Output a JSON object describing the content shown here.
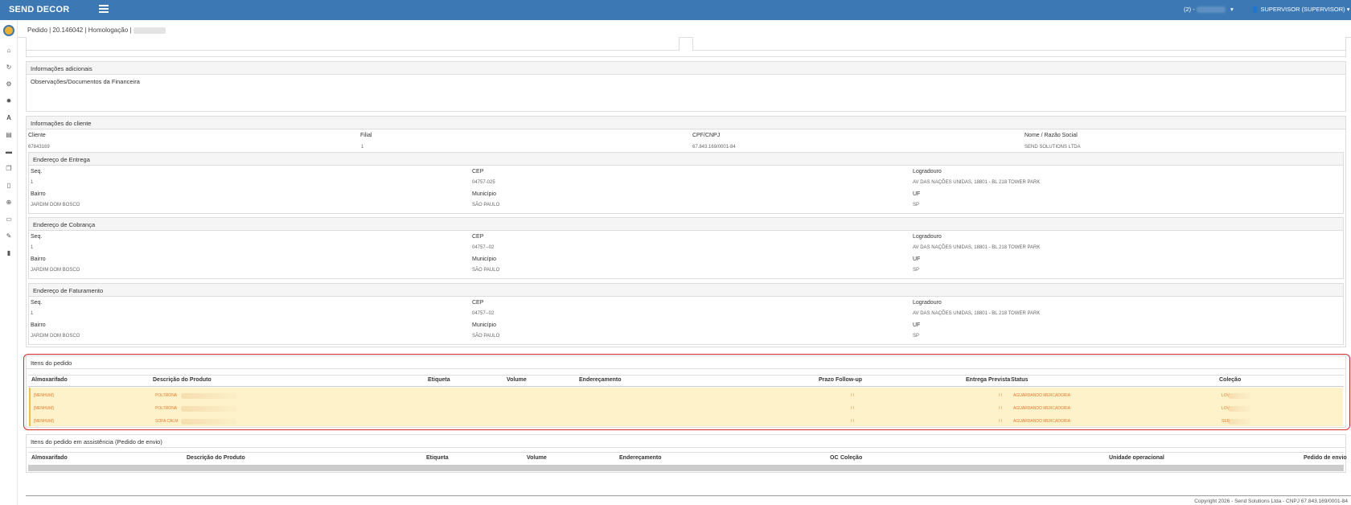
{
  "topbar": {
    "brand": "SEND DECOR",
    "env": "(2) -",
    "user": "SUPERVISOR (SUPERVISOR)"
  },
  "breadcrumb": "Pedido | 20.146042 | Homologação |",
  "additional_info": {
    "title": "Informações adicionais",
    "text": "Observações/Documentos da Financeira"
  },
  "client_info": {
    "title": "Informações do cliente",
    "headers": [
      "Cliente",
      "Filial",
      "CPF/CNPJ",
      "Nome / Razão Social"
    ],
    "values": [
      "67843169",
      "1",
      "67.843.169/0001-84",
      "SEND SOLUTIONS LTDA"
    ]
  },
  "addresses": [
    {
      "title": "Endereço de Entrega",
      "seq": "1",
      "cep": "04757-025",
      "logradouro": "AV DAS NAÇÕES UNIDAS, 18801 - BL 218 TOWER PARK",
      "bairro": "JARDIM DOM BOSCO",
      "municipio": "SÃO PAULO",
      "uf": "SP"
    },
    {
      "title": "Endereço de Cobrança",
      "seq": "1",
      "cep": "04757--02",
      "logradouro": "AV DAS NAÇÕES UNIDAS, 18801 - BL 218 TOWER PARK",
      "bairro": "JARDIM DOM BOSCO",
      "municipio": "SÃO PAULO",
      "uf": "SP"
    },
    {
      "title": "Endereço de Faturamento",
      "seq": "1",
      "cep": "04757--02",
      "logradouro": "AV DAS NAÇÕES UNIDAS, 18801 - BL 218 TOWER PARK",
      "bairro": "JARDIM DOM BOSCO",
      "municipio": "SÃO PAULO",
      "uf": "SP"
    }
  ],
  "address_labels": {
    "seq": "Seq.",
    "cep": "CEP",
    "logradouro": "Logradouro",
    "bairro": "Bairro",
    "municipio": "Município",
    "uf": "UF"
  },
  "items": {
    "title": "Itens do pedido",
    "headers": [
      "Almoxarifado",
      "Descrição do Produto",
      "Etiqueta",
      "Volume",
      "Endereçamento",
      "Prazo Follow-up",
      "Entrega Prevista",
      "Status",
      "Coleção"
    ],
    "rows": [
      {
        "almox": "[NENHUM]",
        "desc": "POLTRONA",
        "prazo": "/ /",
        "entrega": "/ /",
        "status": "AGUARDANDO MERCADORIA",
        "colecao": "LOV"
      },
      {
        "almox": "[NENHUM]",
        "desc": "POLTRONA",
        "prazo": "/ /",
        "entrega": "/ /",
        "status": "AGUARDANDO MERCADORIA",
        "colecao": "LOV"
      },
      {
        "almox": "[NENHUM]",
        "desc": "SOFA CALM",
        "prazo": "/ /",
        "entrega": "/ /",
        "status": "AGUARDANDO MERCADORIA",
        "colecao": "SER"
      }
    ]
  },
  "assist_items": {
    "title": "Itens do pedido em assistência (Pedido de envio)",
    "headers": [
      "Almoxarifado",
      "Descrição do Produto",
      "Etiqueta",
      "Volume",
      "Endereçamento",
      "OC",
      "Coleção",
      "Unidade operacional",
      "Pedido de envio"
    ]
  },
  "footer": "Copyright 2026 - Send Solutions Ltda - CNPJ 67.843.169/0001-84"
}
